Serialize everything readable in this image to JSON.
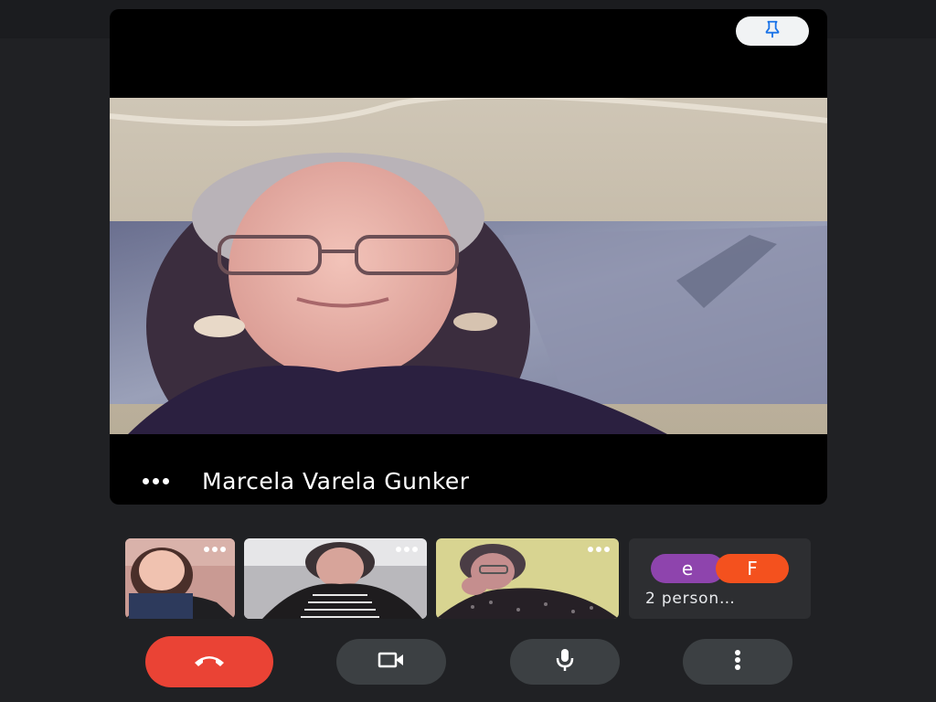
{
  "main": {
    "participant_name": "Marcela Varela Gunker",
    "pin_icon": "pin-icon",
    "more_icon": "more-horizontal-icon"
  },
  "thumbnails": [
    {
      "icon": "more-horizontal-icon"
    },
    {
      "icon": "more-horizontal-icon"
    },
    {
      "icon": "more-horizontal-icon"
    }
  ],
  "people": {
    "avatars": [
      {
        "letter": "e",
        "color": "#8e44ad"
      },
      {
        "letter": "F",
        "color": "#f4511e"
      }
    ],
    "label": "2 person…"
  },
  "controls": {
    "end_call_icon": "end-call-icon",
    "camera_icon": "camera-icon",
    "mic_icon": "microphone-icon",
    "more_icon": "more-vertical-icon",
    "end_call_color": "#ea4335"
  }
}
